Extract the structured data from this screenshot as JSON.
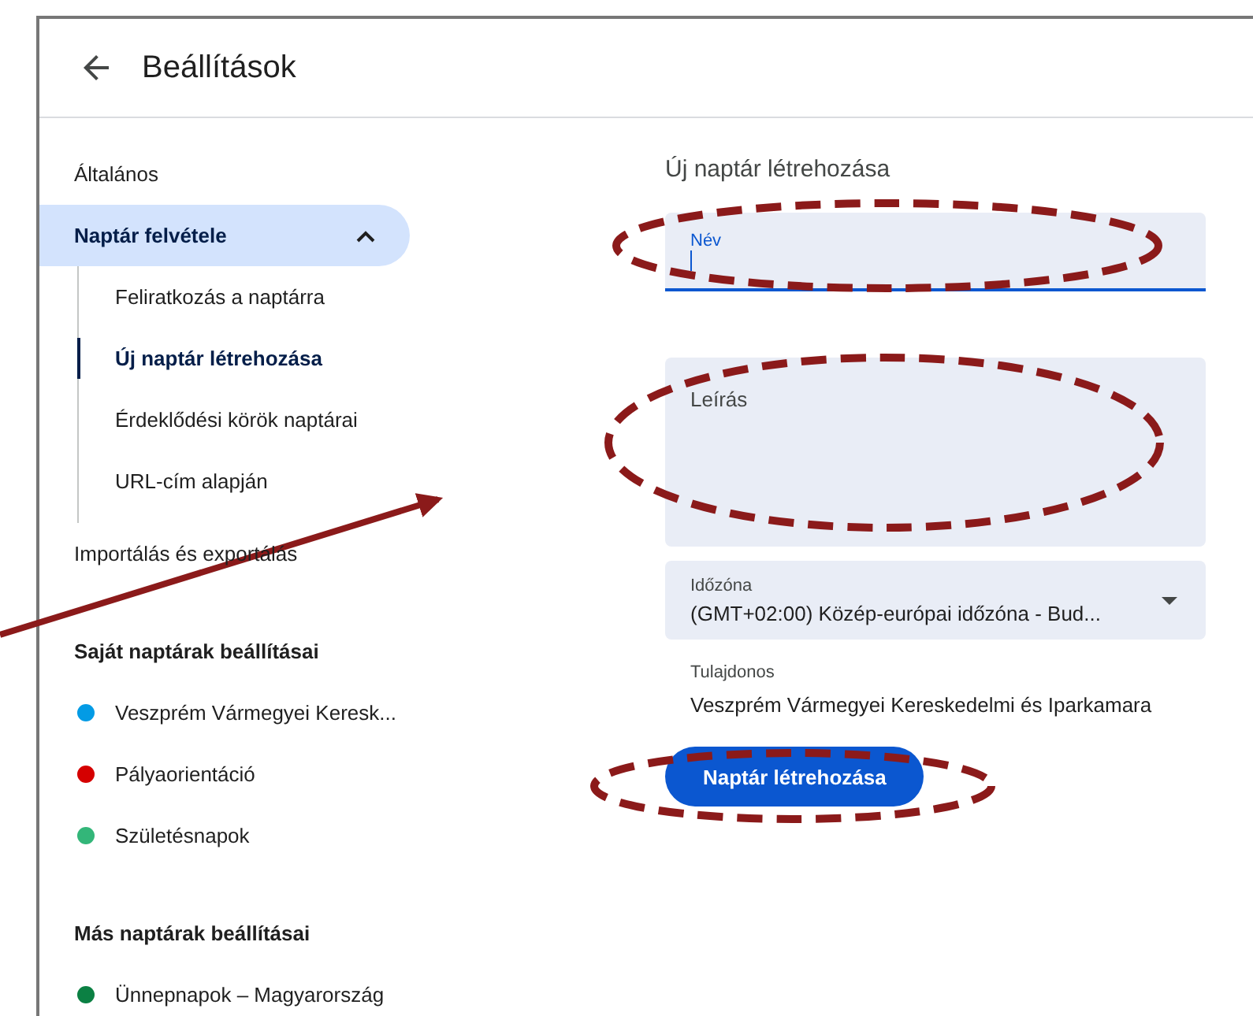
{
  "header": {
    "title": "Beállítások"
  },
  "nav": [
    {
      "label": "Általános",
      "selected": false
    },
    {
      "label": "Naptár felvétele",
      "selected": true,
      "expanded": true,
      "children": [
        {
          "label": "Feliratkozás a naptárra",
          "selected": false
        },
        {
          "label": "Új naptár létrehozása",
          "selected": true
        },
        {
          "label": "Érdeklődési körök naptárai",
          "selected": false
        },
        {
          "label": "URL-cím alapján",
          "selected": false
        }
      ]
    },
    {
      "label": "Importálás és exportálás",
      "selected": false
    }
  ],
  "sections": [
    {
      "heading": "Saját naptárak beállításai",
      "calendars": [
        {
          "name": "Veszprém Vármegyei Keresk...",
          "color": "#039be5"
        },
        {
          "name": "Pályaorientáció",
          "color": "#d50000"
        },
        {
          "name": "Születésnapok",
          "color": "#33b679"
        }
      ]
    },
    {
      "heading": "Más naptárak beállításai",
      "calendars": [
        {
          "name": "Ünnepnapok – Magyarország",
          "color": "#0b8043"
        }
      ]
    }
  ],
  "form": {
    "title": "Új naptár létrehozása",
    "fields": [
      {
        "kind": "text",
        "label": "Név",
        "focused": true
      },
      {
        "kind": "textarea",
        "placeholder": "Leírás"
      },
      {
        "kind": "select",
        "label": "Időzóna",
        "value": "(GMT+02:00) Közép-európai időzóna - Bud..."
      }
    ],
    "owner": {
      "label": "Tulajdonos",
      "value": "Veszprém Vármegyei Kereskedelmi és Iparkamara"
    },
    "button": "Naptár létrehozása"
  }
}
